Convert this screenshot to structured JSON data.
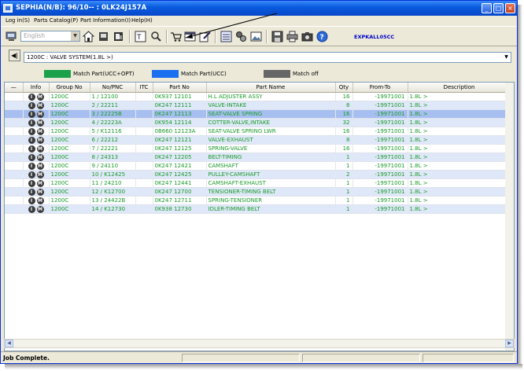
{
  "window": {
    "title": "SEPHIA(N/B): 96/10-- : 0LK24J157A",
    "controls": {
      "minimize": "_",
      "maximize": "□",
      "close": "×"
    }
  },
  "menu": [
    "Log in(S)",
    "Parts Catalog(P)",
    "Part Information(I)",
    "Help(H)"
  ],
  "toolbar": {
    "language": "English",
    "code_label": "EXPKALL05CC"
  },
  "section": {
    "back_glyph": "◀|",
    "selected": "1200C : VALVE SYSTEM(1.8L >)"
  },
  "legend": [
    {
      "label": "Match Part(UCC+OPT)",
      "color": "#1ca14a"
    },
    {
      "label": "Match Part(UCC)",
      "color": "#1a6ff0"
    },
    {
      "label": "Match off",
      "color": "#666666"
    }
  ],
  "table": {
    "columns": [
      "",
      "Info",
      "Group No",
      "No/PNC",
      "ITC",
      "Part No",
      "Part Name",
      "Qty",
      "From-To",
      "Description"
    ],
    "info_icons": [
      "I",
      "M"
    ],
    "rows": [
      {
        "group": "1200C",
        "pnc": "1 / 12100",
        "itc": "",
        "part_no": "0K937 12101",
        "name": "H.L ADJUSTER ASSY",
        "qty": "16",
        "from_to": "-19971001",
        "desc": "1.8L >"
      },
      {
        "group": "1200C",
        "pnc": "2 / 22211",
        "itc": "",
        "part_no": "0K247 12111",
        "name": "VALVE-INTAKE",
        "qty": "8",
        "from_to": "-19971001",
        "desc": "1.8L >"
      },
      {
        "group": "1200C",
        "pnc": "3 / 22225B",
        "itc": "",
        "part_no": "0K247 12113",
        "name": "SEAT-VALVE SPRING",
        "qty": "16",
        "from_to": "-19971001",
        "desc": "1.8L >"
      },
      {
        "group": "1200C",
        "pnc": "4 / 22223A",
        "itc": "",
        "part_no": "0K954 12114",
        "name": "COTTER-VALVE,INTAKE",
        "qty": "32",
        "from_to": "-19971001",
        "desc": "1.8L >"
      },
      {
        "group": "1200C",
        "pnc": "5 / K12116",
        "itc": "",
        "part_no": "0B660 12123A",
        "name": "SEAT-VALVE SPRING LWR",
        "qty": "16",
        "from_to": "-19971001",
        "desc": "1.8L >"
      },
      {
        "group": "1200C",
        "pnc": "6 / 22212",
        "itc": "",
        "part_no": "0K247 12121",
        "name": "VALVE-EXHAUST",
        "qty": "8",
        "from_to": "-19971001",
        "desc": "1.8L >"
      },
      {
        "group": "1200C",
        "pnc": "7 / 22221",
        "itc": "",
        "part_no": "0K247 12125",
        "name": "SPRING-VALVE",
        "qty": "16",
        "from_to": "-19971001",
        "desc": "1.8L >"
      },
      {
        "group": "1200C",
        "pnc": "8 / 24313",
        "itc": "",
        "part_no": "0K247 12205",
        "name": "BELT-TIMING",
        "qty": "1",
        "from_to": "-19971001",
        "desc": "1.8L >"
      },
      {
        "group": "1200C",
        "pnc": "9 / 24110",
        "itc": "",
        "part_no": "0K247 12421",
        "name": "CAMSHAFT",
        "qty": "1",
        "from_to": "-19971001",
        "desc": "1.8L >"
      },
      {
        "group": "1200C",
        "pnc": "10 / K12425",
        "itc": "",
        "part_no": "0K247 12425",
        "name": "PULLEY-CAMSHAFT",
        "qty": "2",
        "from_to": "-19971001",
        "desc": "1.8L >"
      },
      {
        "group": "1200C",
        "pnc": "11 / 24210",
        "itc": "",
        "part_no": "0K247 12441",
        "name": "CAMSHAFT-EXHAUST",
        "qty": "1",
        "from_to": "-19971001",
        "desc": "1.8L >"
      },
      {
        "group": "1200C",
        "pnc": "12 / K12700",
        "itc": "",
        "part_no": "0K247 12700",
        "name": "TENSIONER-TIMING BELT",
        "qty": "1",
        "from_to": "-19971001",
        "desc": "1.8L >"
      },
      {
        "group": "1200C",
        "pnc": "13 / 24422B",
        "itc": "",
        "part_no": "0K247 12711",
        "name": "SPRING-TENSIONER",
        "qty": "1",
        "from_to": "-19971001",
        "desc": "1.8L >"
      },
      {
        "group": "1200C",
        "pnc": "14 / K12730",
        "itc": "",
        "part_no": "0K938 12730",
        "name": "IDLER-TIMING BELT",
        "qty": "1",
        "from_to": "-19971001",
        "desc": "1.8L >"
      }
    ],
    "selected_row": 2
  },
  "status": {
    "text": "Job Complete."
  }
}
